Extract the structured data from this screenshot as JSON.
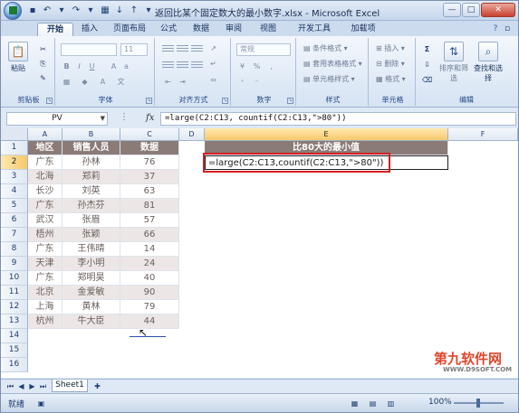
{
  "window": {
    "title": "返回比某个固定数大的最小数字.xlsx - Microsoft Excel",
    "minimize": "—",
    "maximize": "□",
    "close": "✕"
  },
  "tabs": [
    "开始",
    "插入",
    "页面布局",
    "公式",
    "数据",
    "审阅",
    "视图",
    "开发工具",
    "加载项"
  ],
  "ribbon": {
    "clipboard": {
      "label": "剪贴板",
      "paste": "粘贴"
    },
    "font": {
      "label": "字体",
      "name": "",
      "size": "11"
    },
    "alignment": {
      "label": "对齐方式"
    },
    "number": {
      "label": "数字",
      "format": "常规",
      "percent": "%",
      "comma": ","
    },
    "styles": {
      "label": "样式",
      "conditional": "条件格式",
      "table": "套用表格格式",
      "cell": "单元格样式"
    },
    "cells": {
      "label": "单元格",
      "insert": "插入",
      "delete": "删除",
      "format": "格式"
    },
    "editing": {
      "label": "编辑",
      "sort": "排序和筛选",
      "find": "查找和选择"
    }
  },
  "formula_bar": {
    "name_box": "PV",
    "fx": "fx",
    "formula": "=large(C2:C13, countif(C2:C13,\">80\"))"
  },
  "grid": {
    "columns": [
      "A",
      "B",
      "C",
      "D",
      "E",
      "F"
    ],
    "rows": [
      "1",
      "2",
      "3",
      "4",
      "5",
      "6",
      "7",
      "8",
      "9",
      "10",
      "11",
      "12",
      "13",
      "14",
      "15",
      "16"
    ],
    "headers": {
      "A": "地区",
      "B": "销售人员",
      "C": "数据",
      "E": "比80大的最小值"
    },
    "data": [
      [
        "广东",
        "孙林",
        "76"
      ],
      [
        "北海",
        "郑莉",
        "37"
      ],
      [
        "长沙",
        "刘英",
        "63"
      ],
      [
        "广东",
        "孙杰芬",
        "81"
      ],
      [
        "武汉",
        "张眉",
        "57"
      ],
      [
        "梧州",
        "张颖",
        "66"
      ],
      [
        "广东",
        "王伟晴",
        "14"
      ],
      [
        "天津",
        "李小明",
        "24"
      ],
      [
        "广东",
        "郑明昊",
        "40"
      ],
      [
        "北京",
        "金爱敏",
        "90"
      ],
      [
        "上海",
        "黄林",
        "79"
      ],
      [
        "杭州",
        "牛大臣",
        "44"
      ]
    ],
    "editing_cell": "=large(C2:C13,countif(C2:C13,\">80\"))"
  },
  "sheet_tab": "Sheet1",
  "status": {
    "ready": "就绪",
    "zoom": "100%"
  },
  "watermark": {
    "main": "第九软件网",
    "sub": "WWW.D9SOFT.COM"
  },
  "colors": {
    "header_fill": "#8b7b77",
    "alt_row": "#ece7e6",
    "highlight_border": "#d42020"
  }
}
